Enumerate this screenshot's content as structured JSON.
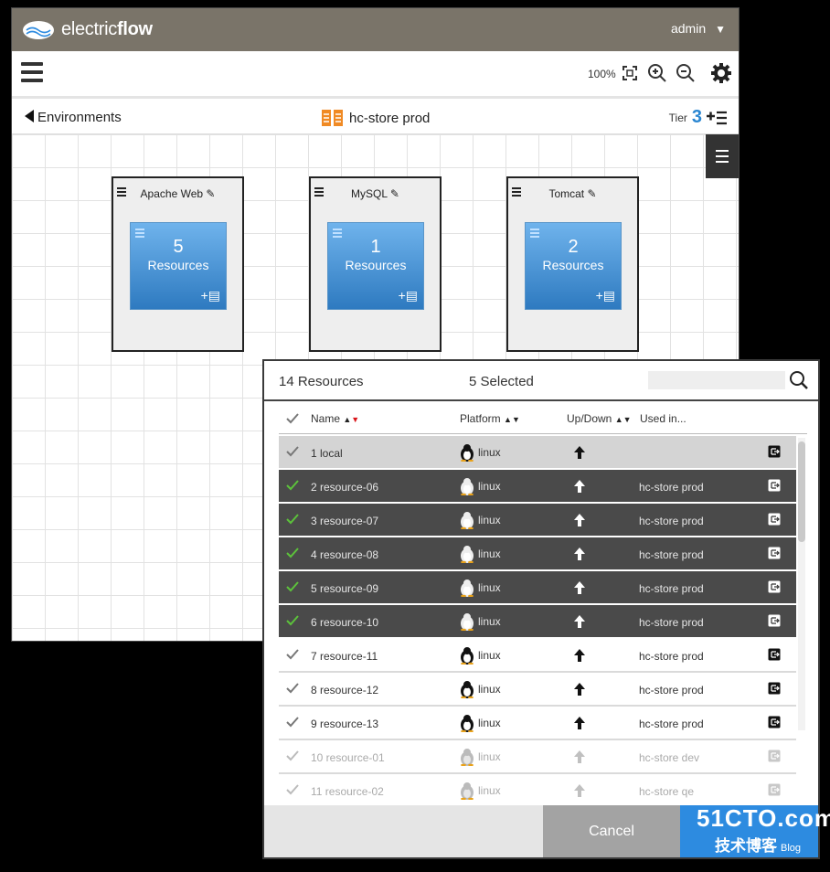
{
  "app": {
    "brand_plain": "electric",
    "brand_bold": "flow",
    "user": "admin"
  },
  "toolbar": {
    "zoom_level": "100%"
  },
  "environment": {
    "back_label": "Environments",
    "name": "hc-store prod",
    "tier_label": "Tier",
    "tier_count": "3"
  },
  "tiers": [
    {
      "name": "Apache Web",
      "count": "5",
      "label": "Resources"
    },
    {
      "name": "MySQL",
      "count": "1",
      "label": "Resources"
    },
    {
      "name": "Tomcat",
      "count": "2",
      "label": "Resources"
    }
  ],
  "dialog": {
    "resource_count": "14 Resources",
    "selected_count": "5 Selected",
    "search_placeholder": "",
    "columns": {
      "name": "Name",
      "platform": "Platform",
      "updown": "Up/Down",
      "used": "Used in..."
    },
    "rows": [
      {
        "name": "1 local",
        "platform": "linux",
        "used": "",
        "state": "gray"
      },
      {
        "name": "2 resource-06",
        "platform": "linux",
        "used": "hc-store prod",
        "state": "sel"
      },
      {
        "name": "3 resource-07",
        "platform": "linux",
        "used": "hc-store prod",
        "state": "sel"
      },
      {
        "name": "4 resource-08",
        "platform": "linux",
        "used": "hc-store prod",
        "state": "sel"
      },
      {
        "name": "5 resource-09",
        "platform": "linux",
        "used": "hc-store prod",
        "state": "sel"
      },
      {
        "name": "6 resource-10",
        "platform": "linux",
        "used": "hc-store prod",
        "state": "sel"
      },
      {
        "name": "7 resource-11",
        "platform": "linux",
        "used": "hc-store prod",
        "state": "norm"
      },
      {
        "name": "8 resource-12",
        "platform": "linux",
        "used": "hc-store prod",
        "state": "norm"
      },
      {
        "name": "9 resource-13",
        "platform": "linux",
        "used": "hc-store prod",
        "state": "norm"
      },
      {
        "name": "10 resource-01",
        "platform": "linux",
        "used": "hc-store dev",
        "state": "dim"
      },
      {
        "name": "11 resource-02",
        "platform": "linux",
        "used": "hc-store qe",
        "state": "dim"
      }
    ],
    "cancel_label": "Cancel"
  },
  "watermark": {
    "line1": "51CTO.com",
    "line2": "技术博客",
    "line3": "Blog"
  },
  "colors": {
    "accent": "#2d8be0",
    "topbar": "#7a7469",
    "selected_row": "#4a4a4a",
    "check_green": "#5cc23b",
    "sort_red": "#d9141a"
  }
}
